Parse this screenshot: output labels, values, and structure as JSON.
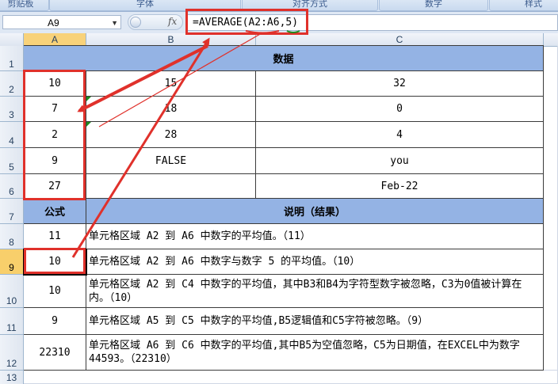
{
  "ribbon": {
    "groups": [
      "剪贴板",
      "字体",
      "对齐方式",
      "数字",
      "样式"
    ]
  },
  "formula_bar": {
    "name_box": "A9",
    "fx_label": "fx",
    "formula": "=AVERAGE(A2:A6,5)"
  },
  "columns": [
    "A",
    "B",
    "C"
  ],
  "rows": [
    "1",
    "2",
    "3",
    "4",
    "5",
    "6",
    "7",
    "8",
    "9",
    "10",
    "11",
    "12",
    "13"
  ],
  "active_cell": "A9",
  "data_header": "数据",
  "data_rows": [
    [
      "10",
      "15",
      "32"
    ],
    [
      "7",
      "18",
      "0"
    ],
    [
      "2",
      "28",
      "4"
    ],
    [
      "9",
      "FALSE",
      "you"
    ],
    [
      "27",
      "",
      "Feb-22"
    ]
  ],
  "formula_header": "公式",
  "explain_header": "说明（结果）",
  "result_rows": [
    {
      "value": "11",
      "text": "单元格区域 A2 到 A6 中数字的平均值。（11）"
    },
    {
      "value": "10",
      "text": "单元格区域 A2 到 A6 中数字与数字 5 的平均值。（10）"
    },
    {
      "value": "10",
      "text": "单元格区域 A2 到 C4 中数字的平均值，其中B3和B4为字符型数字被忽略，C3为0值被计算在内。（10）"
    },
    {
      "value": "9",
      "text": "单元格区域 A5 到 C5 中数字的平均值,B5逻辑值和C5字符被忽略。（9）"
    },
    {
      "value": "22310",
      "text": "单元格区域 A6 到 C6 中数字的平均值,其中B5为空值忽略，C5为日期值，在EXCEL中为数字44593。（22310）"
    }
  ],
  "colors": {
    "header_fill": "#94b3e4",
    "annotation_red": "#e0312b",
    "underline_green": "#1f8a1f"
  }
}
